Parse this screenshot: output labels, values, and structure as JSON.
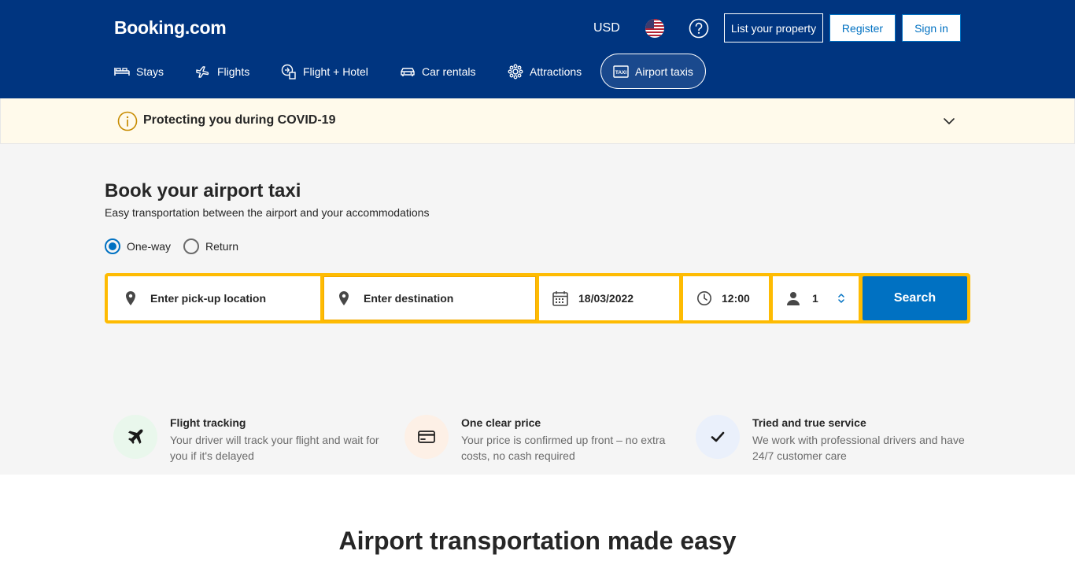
{
  "header": {
    "logo": "Booking.com",
    "currency": "USD",
    "list_property": "List your property",
    "register": "Register",
    "sign_in": "Sign in"
  },
  "nav": {
    "items": [
      {
        "label": "Stays",
        "icon": "bed-icon"
      },
      {
        "label": "Flights",
        "icon": "plane-icon"
      },
      {
        "label": "Flight + Hotel",
        "icon": "flight-hotel-icon"
      },
      {
        "label": "Car rentals",
        "icon": "car-icon"
      },
      {
        "label": "Attractions",
        "icon": "attractions-icon"
      },
      {
        "label": "Airport taxis",
        "icon": "taxi-icon",
        "active": true
      }
    ]
  },
  "covid": {
    "text": "Protecting you during COVID-19"
  },
  "hero": {
    "title": "Book your airport taxi",
    "subtitle": "Easy transportation between the airport and your accommodations"
  },
  "trip_type": {
    "one_way": "One-way",
    "return": "Return",
    "selected": "One-way"
  },
  "search": {
    "pickup_placeholder": "Enter pick-up location",
    "destination_placeholder": "Enter destination",
    "date": "18/03/2022",
    "time": "12:00",
    "passengers": "1",
    "button": "Search"
  },
  "features": [
    {
      "title": "Flight tracking",
      "desc": "Your driver will track your flight and wait for you if it's delayed",
      "icon": "plane-icon"
    },
    {
      "title": "One clear price",
      "desc": "Your price is confirmed up front – no extra costs, no cash required",
      "icon": "credit-card-icon"
    },
    {
      "title": "Tried and true service",
      "desc": "We work with professional drivers and have 24/7 customer care",
      "icon": "checkmark-icon"
    }
  ],
  "lower": {
    "title": "Airport transportation made easy"
  },
  "colors": {
    "brand": "#003580",
    "accent": "#0071c2",
    "search_border": "#febb02"
  }
}
